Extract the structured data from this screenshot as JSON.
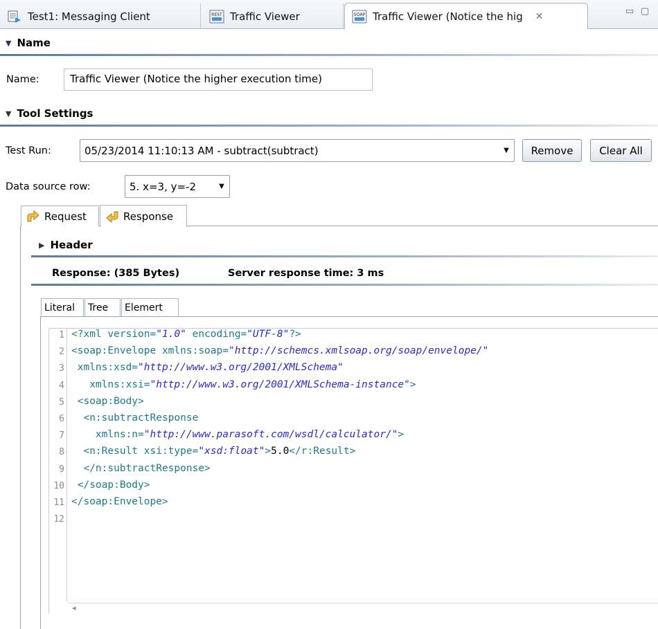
{
  "tabs": [
    {
      "label": "Test1: Messaging Client",
      "icon": "test-suite-icon",
      "active": false
    },
    {
      "label": "Traffic Viewer",
      "icon": "rest-client-icon",
      "icon_text": "REST",
      "active": false
    },
    {
      "label": "Traffic Viewer (Notice the hig",
      "icon": "soap-client-icon",
      "icon_text": "SOAP",
      "active": true
    }
  ],
  "close_glyph": "✕",
  "minimize_glyph": "▭",
  "maximize_glyph": "▢",
  "name_section": {
    "title": "Name",
    "label": "Name:",
    "value": "Traffic Viewer (Notice the higher execution time)"
  },
  "tool_settings": {
    "title": "Tool Settings",
    "test_run_label": "Test Run:",
    "test_run_value": "05/23/2014 11:10:13 AM - subtract(subtract)",
    "remove_label": "Remove",
    "clear_all_label": "Clear All",
    "data_source_label": "Data source row:",
    "data_source_value": "5. x=3, y=-2"
  },
  "message_tabs": [
    {
      "label": "Request",
      "icon": "request-arrow-icon"
    },
    {
      "label": "Response",
      "icon": "response-arrow-icon"
    }
  ],
  "header_section": {
    "title": "Header"
  },
  "response_summary": {
    "size": "Response: (385 Bytes)",
    "time": "Server response time: 3 ms"
  },
  "view_tabs": [
    "Literal",
    "Tree",
    "Elemert"
  ],
  "code_lines": [
    {
      "n": "1",
      "parts": [
        [
          "t-tag",
          "<?xml "
        ],
        [
          "t-attr",
          "version="
        ],
        [
          "t-val",
          "\"1.0\""
        ],
        [
          "t-attr",
          " encoding="
        ],
        [
          "t-val",
          "\"UTF-8\""
        ],
        [
          "t-tag",
          "?>"
        ]
      ]
    },
    {
      "n": "2",
      "parts": [
        [
          "t-tag",
          "<soap:Envelope "
        ],
        [
          "t-attr",
          "xmlns:soap="
        ],
        [
          "t-val",
          "\"http://schemcs.xmlsoap.org/soap/envelope/\""
        ]
      ]
    },
    {
      "n": "3",
      "parts": [
        [
          "t-attr",
          " xmlns:xsd="
        ],
        [
          "t-val",
          "\"http://www.w3.org/2001/XMLSchema\""
        ]
      ]
    },
    {
      "n": "4",
      "parts": [
        [
          "t-attr",
          "   xmlns:xsi="
        ],
        [
          "t-val",
          "\"http://www.w3.org/2001/XMLSchema-instance\""
        ],
        [
          "t-tag",
          ">"
        ]
      ]
    },
    {
      "n": "5",
      "parts": [
        [
          "t-tag",
          " <soap:Body>"
        ]
      ]
    },
    {
      "n": "6",
      "parts": [
        [
          "t-tag",
          "  <n:subtractResponse"
        ]
      ]
    },
    {
      "n": "7",
      "parts": [
        [
          "t-attr",
          "    xmlns:n="
        ],
        [
          "t-val",
          "\"http://www.parasoft.com/wsdl/calculator/\""
        ],
        [
          "t-tag",
          ">"
        ]
      ]
    },
    {
      "n": "8",
      "parts": [
        [
          "t-tag",
          "  <n:Result "
        ],
        [
          "t-attr",
          "xsi:type="
        ],
        [
          "t-val",
          "\"xsd:float\""
        ],
        [
          "t-tag",
          ">"
        ],
        [
          "t-txt",
          "5.0"
        ],
        [
          "t-tag",
          "</r:Result>"
        ]
      ]
    },
    {
      "n": "9",
      "parts": [
        [
          "t-tag",
          "  </n:subtractResponse>"
        ]
      ]
    },
    {
      "n": "10",
      "parts": [
        [
          "t-tag",
          " </soap:Body>"
        ]
      ]
    },
    {
      "n": "11",
      "parts": [
        [
          "t-tag",
          "</soap:Envelope>"
        ]
      ]
    },
    {
      "n": "12",
      "parts": []
    }
  ],
  "scroll_left_glyph": "◂"
}
